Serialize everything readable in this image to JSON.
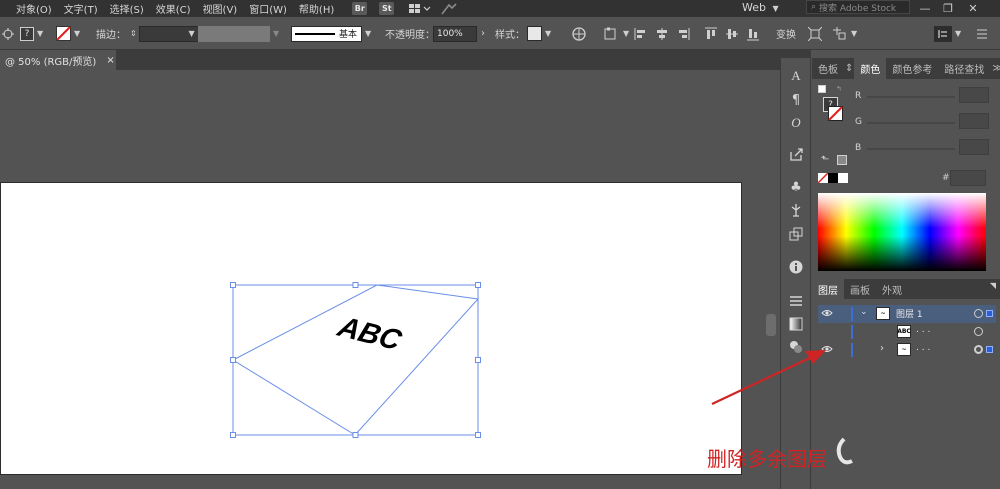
{
  "menubar": {
    "items": [
      "对象(O)",
      "文字(T)",
      "选择(S)",
      "效果(C)",
      "视图(V)",
      "窗口(W)",
      "帮助(H)"
    ],
    "bridge": "Br",
    "stock": "St",
    "workspace": "Web",
    "search_placeholder": "搜索 Adobe Stock"
  },
  "controlbar": {
    "stroke_label": "描边：",
    "brush_label": "基本",
    "opacity_label": "不透明度：",
    "opacity_value": "100%",
    "style_label": "样式：",
    "transform_label": "变换"
  },
  "document": {
    "tab_title": "@ 50% (RGB/预览)",
    "close": "×"
  },
  "artwork": {
    "text": "ABC"
  },
  "color_panel": {
    "tabs": [
      "色板",
      "颜色",
      "颜色参考",
      "路径查找"
    ],
    "active_tab": "颜色",
    "channels": [
      "R",
      "G",
      "B"
    ],
    "hex_label": "#"
  },
  "layers_panel": {
    "tabs": [
      "图层",
      "画板",
      "外观"
    ],
    "active_tab": "图层",
    "rows": [
      {
        "name": "图层 1",
        "thumb": "~"
      },
      {
        "name": ". . .",
        "thumb": "ABC"
      },
      {
        "name": ". . .",
        "thumb": "~"
      }
    ]
  },
  "annotation": {
    "caption": "删除多余图层"
  },
  "colors": {
    "accent": "#3b6fd6",
    "selection": "#4a5e7e",
    "arrow": "#d02424"
  }
}
